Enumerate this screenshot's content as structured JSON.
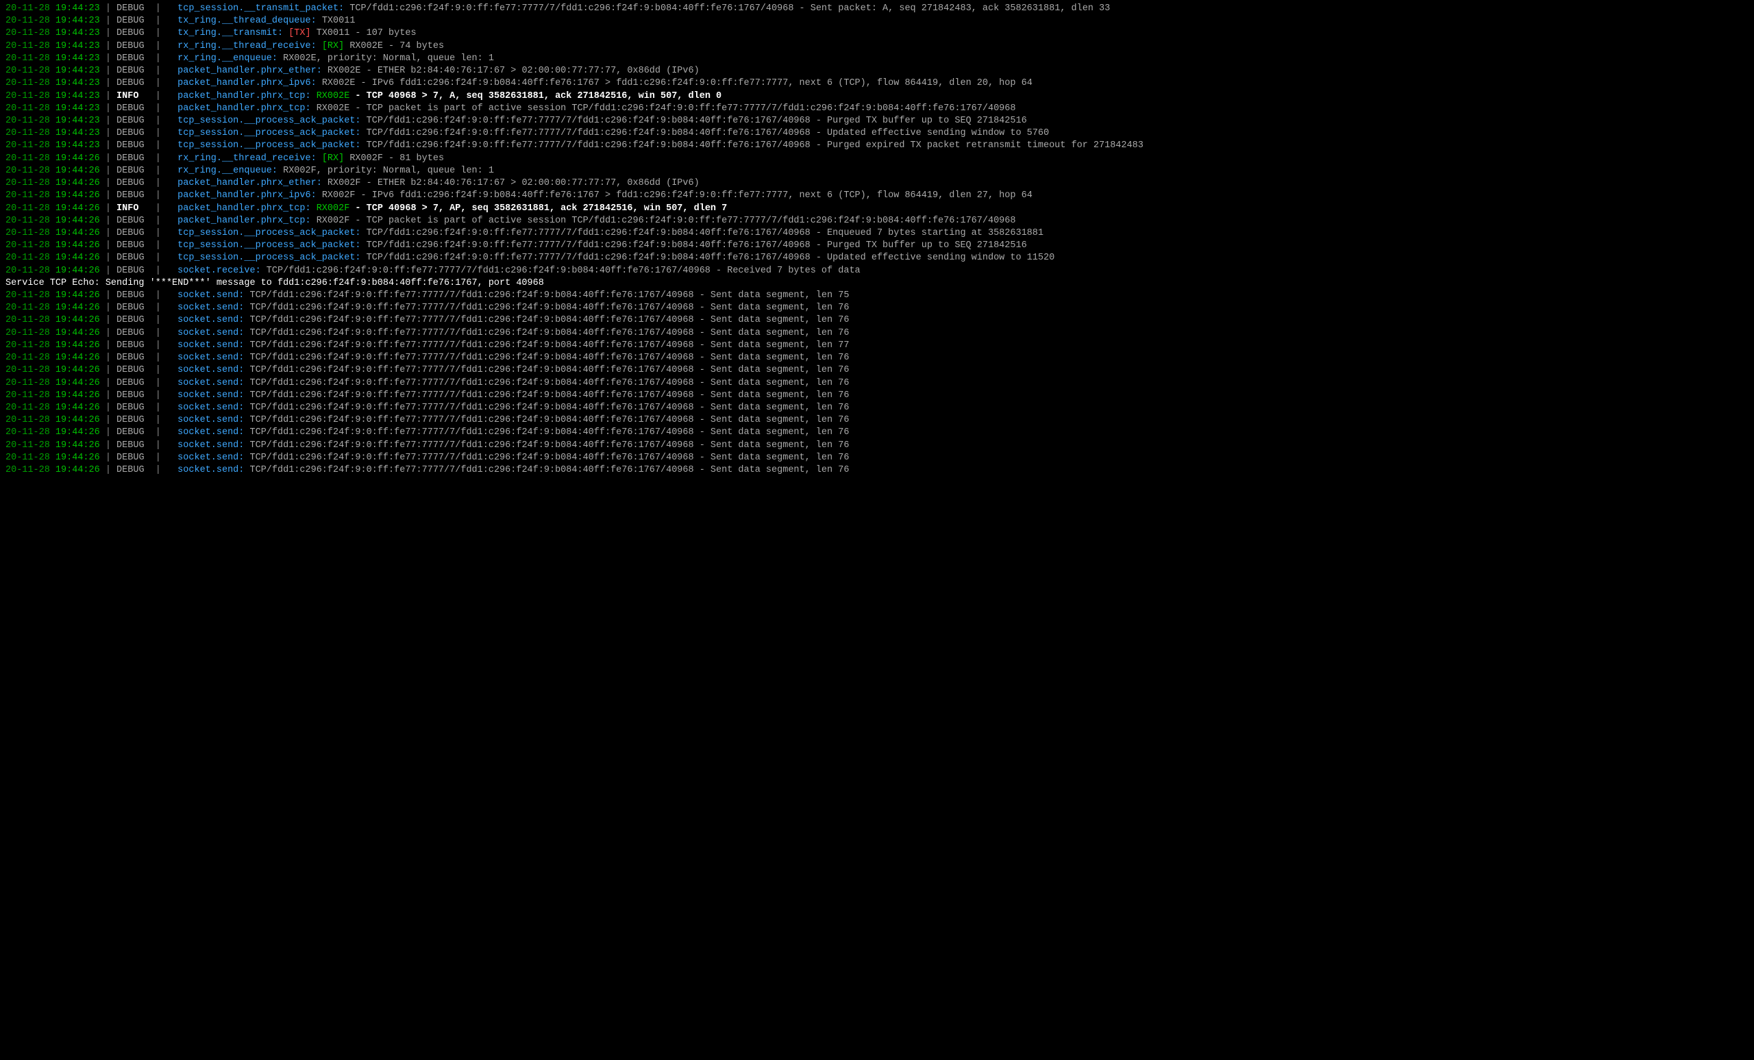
{
  "lines": [
    {
      "type": "log",
      "date": "20-11-28",
      "time": "19:44:23",
      "level": "DEBUG",
      "logger": "tcp_session.__transmit_packet:",
      "segs": [
        {
          "t": " TCP/fdd1:c296:f24f:9:0:ff:fe77:7777/7/fdd1:c296:f24f:9:b084:40ff:fe76:1767/40968 - Sent packet: A, seq 271842483, ack 3582631881, dlen 33",
          "c": "plain"
        }
      ]
    },
    {
      "type": "log",
      "date": "20-11-28",
      "time": "19:44:23",
      "level": "DEBUG",
      "logger": "tx_ring.__thread_dequeue:",
      "segs": [
        {
          "t": " TX0011",
          "c": "plain"
        }
      ]
    },
    {
      "type": "log",
      "date": "20-11-28",
      "time": "19:44:23",
      "level": "DEBUG",
      "logger": "tx_ring.__transmit:",
      "segs": [
        {
          "t": " [TX]",
          "c": "tag-tx"
        },
        {
          "t": " TX0011 - 107 bytes",
          "c": "plain"
        }
      ]
    },
    {
      "type": "log",
      "date": "20-11-28",
      "time": "19:44:23",
      "level": "DEBUG",
      "logger": "rx_ring.__thread_receive:",
      "segs": [
        {
          "t": " [RX]",
          "c": "tag-rx"
        },
        {
          "t": " RX002E - 74 bytes",
          "c": "plain"
        }
      ]
    },
    {
      "type": "log",
      "date": "20-11-28",
      "time": "19:44:23",
      "level": "DEBUG",
      "logger": "rx_ring.__enqueue:",
      "segs": [
        {
          "t": " RX002E, priority: Normal, queue len: 1",
          "c": "plain"
        }
      ]
    },
    {
      "type": "log",
      "date": "20-11-28",
      "time": "19:44:23",
      "level": "DEBUG",
      "logger": "packet_handler.phrx_ether:",
      "segs": [
        {
          "t": " RX002E - ETHER b2:84:40:76:17:67 > 02:00:00:77:77:77, 0x86dd (IPv6)",
          "c": "plain"
        }
      ]
    },
    {
      "type": "log",
      "date": "20-11-28",
      "time": "19:44:23",
      "level": "DEBUG",
      "logger": "packet_handler.phrx_ipv6:",
      "segs": [
        {
          "t": " RX002E - IPv6 fdd1:c296:f24f:9:b084:40ff:fe76:1767 > fdd1:c296:f24f:9:0:ff:fe77:7777, next 6 (TCP), flow 864419, dlen 20, hop 64",
          "c": "plain"
        }
      ]
    },
    {
      "type": "log",
      "date": "20-11-28",
      "time": "19:44:23",
      "level": "INFO",
      "logger": "packet_handler.phrx_tcp:",
      "segs": [
        {
          "t": " RX002E",
          "c": "tag-rx"
        },
        {
          "t": " - TCP 40968 > 7, A, seq 3582631881, ack 271842516, win 507, dlen 0",
          "c": "info-msg"
        }
      ]
    },
    {
      "type": "log",
      "date": "20-11-28",
      "time": "19:44:23",
      "level": "DEBUG",
      "logger": "packet_handler.phrx_tcp:",
      "segs": [
        {
          "t": " RX002E - TCP packet is part of active session TCP/fdd1:c296:f24f:9:0:ff:fe77:7777/7/fdd1:c296:f24f:9:b084:40ff:fe76:1767/40968",
          "c": "plain"
        }
      ]
    },
    {
      "type": "log",
      "date": "20-11-28",
      "time": "19:44:23",
      "level": "DEBUG",
      "logger": "tcp_session.__process_ack_packet:",
      "segs": [
        {
          "t": " TCP/fdd1:c296:f24f:9:0:ff:fe77:7777/7/fdd1:c296:f24f:9:b084:40ff:fe76:1767/40968 - Purged TX buffer up to SEQ 271842516",
          "c": "plain"
        }
      ]
    },
    {
      "type": "log",
      "date": "20-11-28",
      "time": "19:44:23",
      "level": "DEBUG",
      "logger": "tcp_session.__process_ack_packet:",
      "segs": [
        {
          "t": " TCP/fdd1:c296:f24f:9:0:ff:fe77:7777/7/fdd1:c296:f24f:9:b084:40ff:fe76:1767/40968 - Updated effective sending window to 5760",
          "c": "plain"
        }
      ]
    },
    {
      "type": "log",
      "date": "20-11-28",
      "time": "19:44:23",
      "level": "DEBUG",
      "logger": "tcp_session.__process_ack_packet:",
      "segs": [
        {
          "t": " TCP/fdd1:c296:f24f:9:0:ff:fe77:7777/7/fdd1:c296:f24f:9:b084:40ff:fe76:1767/40968 - Purged expired TX packet retransmit timeout for 271842483",
          "c": "plain"
        }
      ]
    },
    {
      "type": "log",
      "date": "20-11-28",
      "time": "19:44:26",
      "level": "DEBUG",
      "logger": "rx_ring.__thread_receive:",
      "segs": [
        {
          "t": " [RX]",
          "c": "tag-rx"
        },
        {
          "t": " RX002F - 81 bytes",
          "c": "plain"
        }
      ]
    },
    {
      "type": "log",
      "date": "20-11-28",
      "time": "19:44:26",
      "level": "DEBUG",
      "logger": "rx_ring.__enqueue:",
      "segs": [
        {
          "t": " RX002F, priority: Normal, queue len: 1",
          "c": "plain"
        }
      ]
    },
    {
      "type": "log",
      "date": "20-11-28",
      "time": "19:44:26",
      "level": "DEBUG",
      "logger": "packet_handler.phrx_ether:",
      "segs": [
        {
          "t": " RX002F - ETHER b2:84:40:76:17:67 > 02:00:00:77:77:77, 0x86dd (IPv6)",
          "c": "plain"
        }
      ]
    },
    {
      "type": "log",
      "date": "20-11-28",
      "time": "19:44:26",
      "level": "DEBUG",
      "logger": "packet_handler.phrx_ipv6:",
      "segs": [
        {
          "t": " RX002F - IPv6 fdd1:c296:f24f:9:b084:40ff:fe76:1767 > fdd1:c296:f24f:9:0:ff:fe77:7777, next 6 (TCP), flow 864419, dlen 27, hop 64",
          "c": "plain"
        }
      ]
    },
    {
      "type": "log",
      "date": "20-11-28",
      "time": "19:44:26",
      "level": "INFO",
      "logger": "packet_handler.phrx_tcp:",
      "segs": [
        {
          "t": " RX002F",
          "c": "tag-rx"
        },
        {
          "t": " - TCP 40968 > 7, AP, seq 3582631881, ack 271842516, win 507, dlen 7",
          "c": "info-msg"
        }
      ]
    },
    {
      "type": "log",
      "date": "20-11-28",
      "time": "19:44:26",
      "level": "DEBUG",
      "logger": "packet_handler.phrx_tcp:",
      "segs": [
        {
          "t": " RX002F - TCP packet is part of active session TCP/fdd1:c296:f24f:9:0:ff:fe77:7777/7/fdd1:c296:f24f:9:b084:40ff:fe76:1767/40968",
          "c": "plain"
        }
      ]
    },
    {
      "type": "log",
      "date": "20-11-28",
      "time": "19:44:26",
      "level": "DEBUG",
      "logger": "tcp_session.__process_ack_packet:",
      "segs": [
        {
          "t": " TCP/fdd1:c296:f24f:9:0:ff:fe77:7777/7/fdd1:c296:f24f:9:b084:40ff:fe76:1767/40968 - Enqueued 7 bytes starting at 3582631881",
          "c": "plain"
        }
      ]
    },
    {
      "type": "log",
      "date": "20-11-28",
      "time": "19:44:26",
      "level": "DEBUG",
      "logger": "tcp_session.__process_ack_packet:",
      "segs": [
        {
          "t": " TCP/fdd1:c296:f24f:9:0:ff:fe77:7777/7/fdd1:c296:f24f:9:b084:40ff:fe76:1767/40968 - Purged TX buffer up to SEQ 271842516",
          "c": "plain"
        }
      ]
    },
    {
      "type": "log",
      "date": "20-11-28",
      "time": "19:44:26",
      "level": "DEBUG",
      "logger": "tcp_session.__process_ack_packet:",
      "segs": [
        {
          "t": " TCP/fdd1:c296:f24f:9:0:ff:fe77:7777/7/fdd1:c296:f24f:9:b084:40ff:fe76:1767/40968 - Updated effective sending window to 11520",
          "c": "plain"
        }
      ]
    },
    {
      "type": "log",
      "date": "20-11-28",
      "time": "19:44:26",
      "level": "DEBUG",
      "logger": "socket.receive:",
      "segs": [
        {
          "t": " TCP/fdd1:c296:f24f:9:0:ff:fe77:7777/7/fdd1:c296:f24f:9:b084:40ff:fe76:1767/40968 - Received 7 bytes of data",
          "c": "plain"
        }
      ]
    },
    {
      "type": "raw",
      "text": "Service TCP Echo: Sending '***END***' message to fdd1:c296:f24f:9:b084:40ff:fe76:1767, port 40968"
    },
    {
      "type": "log",
      "date": "20-11-28",
      "time": "19:44:26",
      "level": "DEBUG",
      "logger": "socket.send:",
      "segs": [
        {
          "t": " TCP/fdd1:c296:f24f:9:0:ff:fe77:7777/7/fdd1:c296:f24f:9:b084:40ff:fe76:1767/40968 - Sent data segment, len 75",
          "c": "plain"
        }
      ]
    },
    {
      "type": "log",
      "date": "20-11-28",
      "time": "19:44:26",
      "level": "DEBUG",
      "logger": "socket.send:",
      "segs": [
        {
          "t": " TCP/fdd1:c296:f24f:9:0:ff:fe77:7777/7/fdd1:c296:f24f:9:b084:40ff:fe76:1767/40968 - Sent data segment, len 76",
          "c": "plain"
        }
      ]
    },
    {
      "type": "log",
      "date": "20-11-28",
      "time": "19:44:26",
      "level": "DEBUG",
      "logger": "socket.send:",
      "segs": [
        {
          "t": " TCP/fdd1:c296:f24f:9:0:ff:fe77:7777/7/fdd1:c296:f24f:9:b084:40ff:fe76:1767/40968 - Sent data segment, len 76",
          "c": "plain"
        }
      ]
    },
    {
      "type": "log",
      "date": "20-11-28",
      "time": "19:44:26",
      "level": "DEBUG",
      "logger": "socket.send:",
      "segs": [
        {
          "t": " TCP/fdd1:c296:f24f:9:0:ff:fe77:7777/7/fdd1:c296:f24f:9:b084:40ff:fe76:1767/40968 - Sent data segment, len 76",
          "c": "plain"
        }
      ]
    },
    {
      "type": "log",
      "date": "20-11-28",
      "time": "19:44:26",
      "level": "DEBUG",
      "logger": "socket.send:",
      "segs": [
        {
          "t": " TCP/fdd1:c296:f24f:9:0:ff:fe77:7777/7/fdd1:c296:f24f:9:b084:40ff:fe76:1767/40968 - Sent data segment, len 77",
          "c": "plain"
        }
      ]
    },
    {
      "type": "log",
      "date": "20-11-28",
      "time": "19:44:26",
      "level": "DEBUG",
      "logger": "socket.send:",
      "segs": [
        {
          "t": " TCP/fdd1:c296:f24f:9:0:ff:fe77:7777/7/fdd1:c296:f24f:9:b084:40ff:fe76:1767/40968 - Sent data segment, len 76",
          "c": "plain"
        }
      ]
    },
    {
      "type": "log",
      "date": "20-11-28",
      "time": "19:44:26",
      "level": "DEBUG",
      "logger": "socket.send:",
      "segs": [
        {
          "t": " TCP/fdd1:c296:f24f:9:0:ff:fe77:7777/7/fdd1:c296:f24f:9:b084:40ff:fe76:1767/40968 - Sent data segment, len 76",
          "c": "plain"
        }
      ]
    },
    {
      "type": "log",
      "date": "20-11-28",
      "time": "19:44:26",
      "level": "DEBUG",
      "logger": "socket.send:",
      "segs": [
        {
          "t": " TCP/fdd1:c296:f24f:9:0:ff:fe77:7777/7/fdd1:c296:f24f:9:b084:40ff:fe76:1767/40968 - Sent data segment, len 76",
          "c": "plain"
        }
      ]
    },
    {
      "type": "log",
      "date": "20-11-28",
      "time": "19:44:26",
      "level": "DEBUG",
      "logger": "socket.send:",
      "segs": [
        {
          "t": " TCP/fdd1:c296:f24f:9:0:ff:fe77:7777/7/fdd1:c296:f24f:9:b084:40ff:fe76:1767/40968 - Sent data segment, len 76",
          "c": "plain"
        }
      ]
    },
    {
      "type": "log",
      "date": "20-11-28",
      "time": "19:44:26",
      "level": "DEBUG",
      "logger": "socket.send:",
      "segs": [
        {
          "t": " TCP/fdd1:c296:f24f:9:0:ff:fe77:7777/7/fdd1:c296:f24f:9:b084:40ff:fe76:1767/40968 - Sent data segment, len 76",
          "c": "plain"
        }
      ]
    },
    {
      "type": "log",
      "date": "20-11-28",
      "time": "19:44:26",
      "level": "DEBUG",
      "logger": "socket.send:",
      "segs": [
        {
          "t": " TCP/fdd1:c296:f24f:9:0:ff:fe77:7777/7/fdd1:c296:f24f:9:b084:40ff:fe76:1767/40968 - Sent data segment, len 76",
          "c": "plain"
        }
      ]
    },
    {
      "type": "log",
      "date": "20-11-28",
      "time": "19:44:26",
      "level": "DEBUG",
      "logger": "socket.send:",
      "segs": [
        {
          "t": " TCP/fdd1:c296:f24f:9:0:ff:fe77:7777/7/fdd1:c296:f24f:9:b084:40ff:fe76:1767/40968 - Sent data segment, len 76",
          "c": "plain"
        }
      ]
    },
    {
      "type": "log",
      "date": "20-11-28",
      "time": "19:44:26",
      "level": "DEBUG",
      "logger": "socket.send:",
      "segs": [
        {
          "t": " TCP/fdd1:c296:f24f:9:0:ff:fe77:7777/7/fdd1:c296:f24f:9:b084:40ff:fe76:1767/40968 - Sent data segment, len 76",
          "c": "plain"
        }
      ]
    },
    {
      "type": "log",
      "date": "20-11-28",
      "time": "19:44:26",
      "level": "DEBUG",
      "logger": "socket.send:",
      "segs": [
        {
          "t": " TCP/fdd1:c296:f24f:9:0:ff:fe77:7777/7/fdd1:c296:f24f:9:b084:40ff:fe76:1767/40968 - Sent data segment, len 76",
          "c": "plain"
        }
      ]
    },
    {
      "type": "log",
      "date": "20-11-28",
      "time": "19:44:26",
      "level": "DEBUG",
      "logger": "socket.send:",
      "segs": [
        {
          "t": " TCP/fdd1:c296:f24f:9:0:ff:fe77:7777/7/fdd1:c296:f24f:9:b084:40ff:fe76:1767/40968 - Sent data segment, len 76",
          "c": "plain"
        }
      ]
    }
  ],
  "levelPad": 6
}
